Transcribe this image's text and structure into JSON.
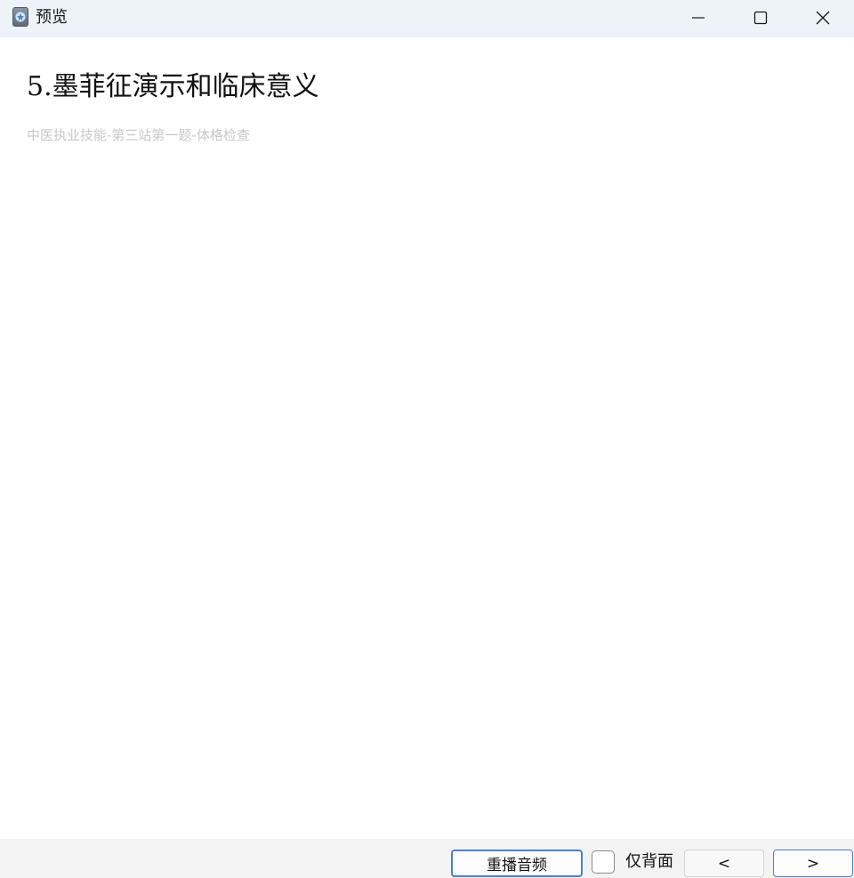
{
  "window": {
    "title": "预览",
    "icon": "app-icon"
  },
  "titlebar_buttons": {
    "minimize_icon": "minimize-icon",
    "maximize_icon": "maximize-icon",
    "close_icon": "close-icon"
  },
  "content": {
    "heading": "5.墨菲征演示和临床意义",
    "subheading": "中医执业技能-第三站第一题-体格检查"
  },
  "bottombar": {
    "replay_label": "重播音频",
    "back_only_label": "仅背面",
    "back_only_checked": false,
    "prev_label": "<",
    "next_label": ">"
  },
  "colors": {
    "titlebar_bg": "#eef2f9",
    "accent": "#4a7fd6",
    "subheading": "#c8c8c8",
    "bottombar_bg": "#f3f3f3"
  }
}
